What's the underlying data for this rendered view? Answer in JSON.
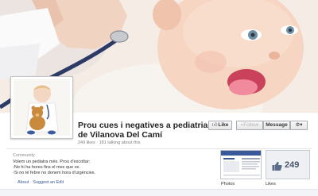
{
  "page": {
    "title": "Prou cues i negatives a pediatria de Vilanova Del Camí",
    "stats": "249 likes · 181 talking about this"
  },
  "actions": {
    "like_label": "Like",
    "follow_label": "Follow",
    "message_label": "Message",
    "settings_icon": "gear-icon"
  },
  "about": {
    "category": "Community",
    "lines": [
      "Volem un pediatra més. Prou d'escoltar:",
      "-No hi ha hores fins el mes que ve.",
      "-Si no té febre no donem hora d'urgències."
    ],
    "about_link": "About",
    "separator": "·",
    "suggest_edit_link": "Suggest an Edit"
  },
  "tiles": {
    "photos_label": "Photos",
    "likes_label": "Likes",
    "likes_count": "249"
  },
  "colors": {
    "link": "#3b5998",
    "muted": "#808080"
  }
}
